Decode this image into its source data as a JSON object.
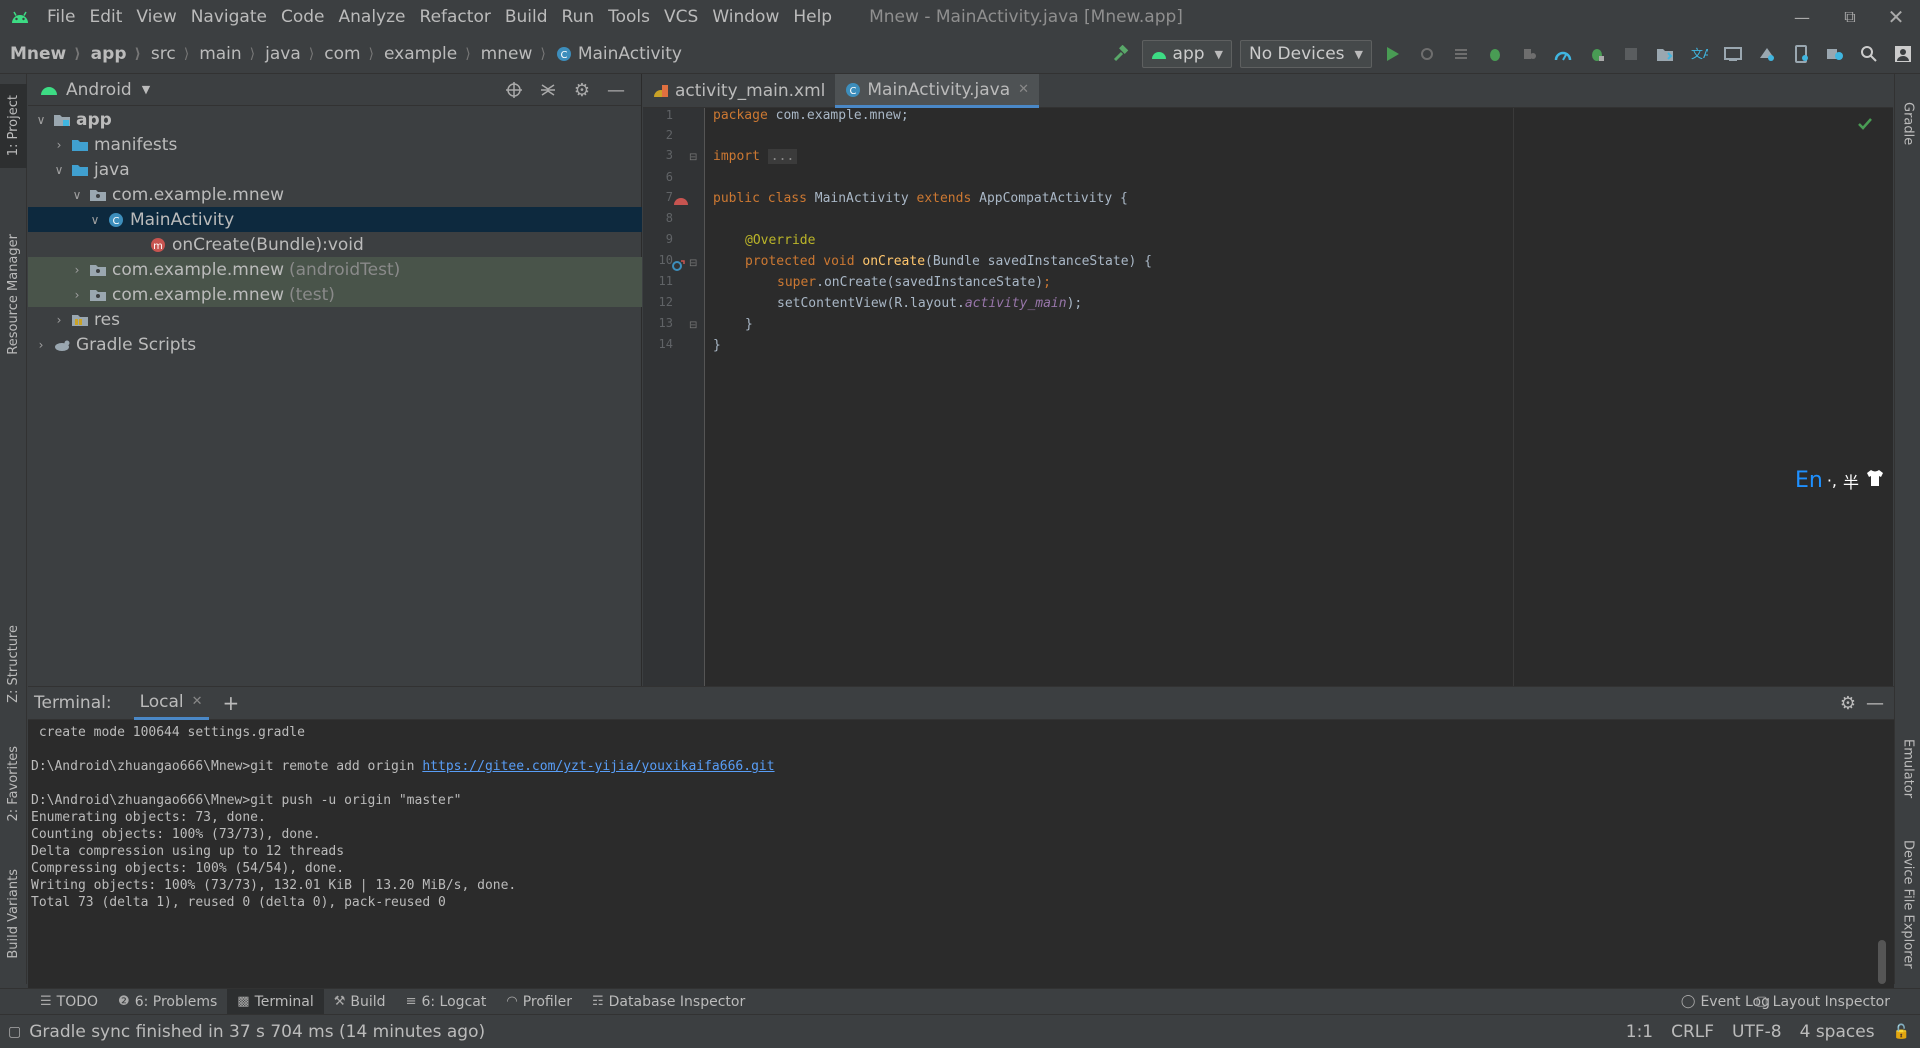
{
  "window": {
    "title": "Mnew - MainActivity.java [Mnew.app]",
    "menu": [
      "File",
      "Edit",
      "View",
      "Navigate",
      "Code",
      "Analyze",
      "Refactor",
      "Build",
      "Run",
      "Tools",
      "VCS",
      "Window",
      "Help"
    ]
  },
  "breadcrumb": [
    "Mnew",
    "app",
    "src",
    "main",
    "java",
    "com",
    "example",
    "mnew",
    "MainActivity"
  ],
  "toolbar": {
    "config": "app",
    "device": "No Devices"
  },
  "left_tabs": [
    "1: Project",
    "Resource Manager",
    "Z: Structure",
    "2: Favorites",
    "Build Variants"
  ],
  "right_tabs": [
    "Gradle",
    "Emulator",
    "Device File Explorer"
  ],
  "project": {
    "view": "Android",
    "tree": [
      {
        "label": "app",
        "muted": ""
      },
      {
        "label": "manifests",
        "muted": ""
      },
      {
        "label": "java",
        "muted": ""
      },
      {
        "label": "com.example.mnew",
        "muted": ""
      },
      {
        "label": "MainActivity",
        "muted": ""
      },
      {
        "label": "onCreate(Bundle):void",
        "muted": ""
      },
      {
        "label": "com.example.mnew",
        "muted": "(androidTest)"
      },
      {
        "label": "com.example.mnew",
        "muted": "(test)"
      },
      {
        "label": "res",
        "muted": ""
      },
      {
        "label": "Gradle Scripts",
        "muted": ""
      }
    ]
  },
  "editor": {
    "tabs": [
      {
        "label": "activity_main.xml"
      },
      {
        "label": "MainActivity.java"
      }
    ],
    "line_numbers": [
      "1",
      "2",
      "3",
      "6",
      "7",
      "8",
      "9",
      "10",
      "11",
      "12",
      "13",
      "14"
    ],
    "code": {
      "l1_kw": "package",
      "l1_rest": " com.example.mnew;",
      "l3_kw": "import",
      "l3_fold": "...",
      "l7_kw": "public class",
      "l7_name": " MainActivity ",
      "l7_kw2": "extends",
      "l7_rest": " AppCompatActivity {",
      "l9_ann": "@Override",
      "l10_kw": "protected void",
      "l10_fn": "onCreate",
      "l10_rest": "(Bundle savedInstanceState) {",
      "l11_kw": "super",
      "l11_rest": ".onCreate(savedInstanceState)",
      "l11_semi": ";",
      "l12_a": "setContentView(R.layout.",
      "l12_it": "activity_main",
      "l12_b": ");",
      "l13": "}",
      "l14": "}"
    },
    "ime": {
      "lang": "En",
      "punct": "·,",
      "width": "半"
    }
  },
  "terminal": {
    "label": "Terminal:",
    "tab": "Local",
    "lines": [
      " create mode 100644 settings.gradle",
      "",
      "D:\\Android\\zhuangao666\\Mnew>git remote add origin ",
      "",
      "D:\\Android\\zhuangao666\\Mnew>git push -u origin \"master\"",
      "Enumerating objects: 73, done.",
      "Counting objects: 100% (73/73), done.",
      "Delta compression using up to 12 threads",
      "Compressing objects: 100% (54/54), done.",
      "Writing objects: 100% (73/73), 132.01 KiB | 13.20 MiB/s, done.",
      "Total 73 (delta 1), reused 0 (delta 0), pack-reused 0"
    ],
    "link": "https://gitee.com/yzt-yijia/youxikaifa666.git"
  },
  "bottom_tools": {
    "todo": "TODO",
    "problems": "6: Problems",
    "terminal": "Terminal",
    "build": "Build",
    "logcat": "6: Logcat",
    "profiler": "Profiler",
    "db": "Database Inspector",
    "event_log": "Event Log",
    "layout_inspector": "Layout Inspector"
  },
  "status": {
    "message": "Gradle sync finished in 37 s 704 ms (14 minutes ago)",
    "position": "1:1",
    "line_sep": "CRLF",
    "encoding": "UTF-8",
    "indent": "4 spaces"
  },
  "colors": {
    "bg": "#3c3f41",
    "editor_bg": "#2b2b2b",
    "keyword": "#cc7832",
    "selection": "#0d293e",
    "green_row": "#49544a",
    "accent": "#4a88c7",
    "link": "#589df6"
  }
}
